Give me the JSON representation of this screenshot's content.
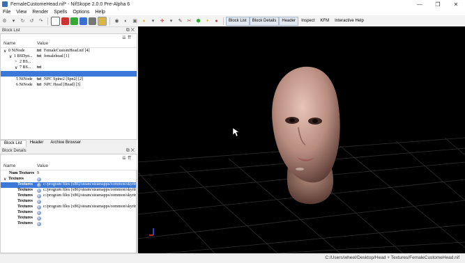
{
  "window": {
    "title": "FemaleCustomeHead.nif* - NifSkope 2.0.0 Pre-Alpha 6",
    "minimize": "—",
    "maximize": "❐",
    "close": "✕"
  },
  "menu": [
    "File",
    "View",
    "Render",
    "Spells",
    "Options",
    "Help"
  ],
  "toolbar": {
    "tabs": [
      "Block List",
      "Block Details",
      "Header",
      "Inspect",
      "KFM",
      "Interactive Help"
    ],
    "active_tabs": [
      "Block List",
      "Block Details",
      "Header"
    ]
  },
  "block_list": {
    "panel_title": "Block List",
    "col_name": "Name",
    "col_value": "Value",
    "rows": [
      {
        "arrow": "∨",
        "name": "0 NiNode",
        "icon": "txt",
        "value": "FemaleCustomHead.nif [4]"
      },
      {
        "arrow": "∨",
        "name": "1 BSDyn...",
        "icon": "txt",
        "value": "femalehead [1]"
      },
      {
        "arrow": ">",
        "name": "2 BS...",
        "icon": "",
        "value": ""
      },
      {
        "arrow": "∨",
        "name": "7 BS...",
        "icon": "txt",
        "value": ""
      },
      {
        "arrow": "",
        "name": "",
        "icon": "",
        "value": ""
      },
      {
        "arrow": "",
        "name": "5 NiNode",
        "icon": "txt",
        "value": "NPC Spine2 [Spn2] [2]"
      },
      {
        "arrow": "",
        "name": "6 NiNode",
        "icon": "txt",
        "value": "NPC Head [Head] [3]"
      }
    ]
  },
  "bottom_tabs": [
    "Block List",
    "Header",
    "Archive Browser"
  ],
  "block_details": {
    "panel_title": "Block Details",
    "col_name": "Name",
    "col_value": "Value",
    "rows": [
      {
        "name": "Num Textures",
        "value": "9",
        "icon": false
      },
      {
        "name": "Textures",
        "value": "",
        "icon": true,
        "expand": "∨"
      },
      {
        "name": "Textures",
        "value": "c:/program files (x86)/steam/steamapps/common/skyrim",
        "icon": true,
        "selected": true
      },
      {
        "name": "Textures",
        "value": "c:/program files (x86)/steam/steamapps/common/skyrim",
        "icon": true
      },
      {
        "name": "Textures",
        "value": "c:/program files (x86)/steam/steamapps/common/skyrim",
        "icon": true
      },
      {
        "name": "Textures",
        "value": "",
        "icon": true
      },
      {
        "name": "Textures",
        "value": "c:/program files (x86)/steam/steamapps/common/skyrim",
        "icon": true
      },
      {
        "name": "Textures",
        "value": "",
        "icon": true
      },
      {
        "name": "Textures",
        "value": "",
        "icon": true
      },
      {
        "name": "Textures",
        "value": "",
        "icon": true
      }
    ]
  },
  "status": {
    "path": "C:/Users/wheel/Desktop/Head + Textures/FemaleCustomeHead.nif"
  },
  "colors": {
    "selection": "#3b78d8",
    "viewport_bg": "#000000",
    "grid": "#3a3a3a"
  }
}
